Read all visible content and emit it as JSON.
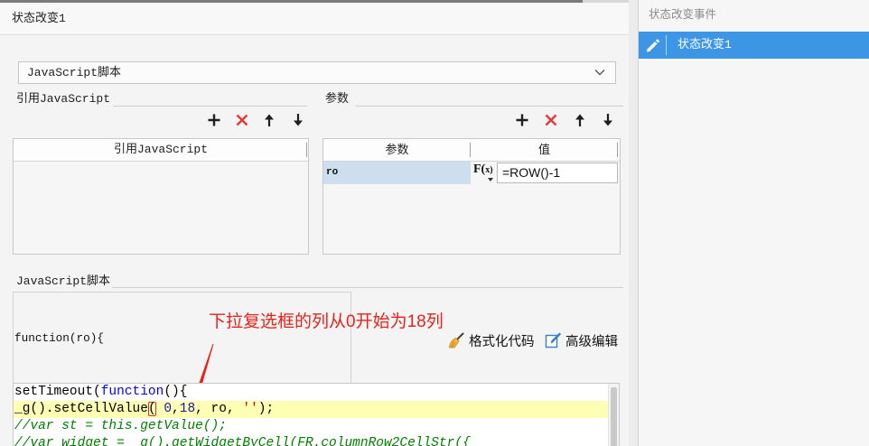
{
  "window": {
    "title": "状态改变1"
  },
  "type_select": {
    "value": "JavaScript脚本",
    "icon": "chevron-down-icon"
  },
  "ref_js": {
    "label": "引用JavaScript",
    "header": "引用JavaScript",
    "toolbar_icons": [
      "add-icon",
      "delete-icon",
      "move-up-icon",
      "move-down-icon"
    ],
    "rows": []
  },
  "params": {
    "label": "参数",
    "headers": {
      "name": "参数",
      "value": "值"
    },
    "toolbar_icons": [
      "add-icon",
      "delete-icon",
      "move-up-icon",
      "move-down-icon"
    ],
    "rows": [
      {
        "name": "ro",
        "formula_button": "F(x)",
        "value": "=ROW()-1",
        "selected": true
      }
    ]
  },
  "script": {
    "label": "JavaScript脚本",
    "signature": "function(ro){",
    "format_button": {
      "label": "格式化代码",
      "icon": "broom-icon"
    },
    "advanced_button": {
      "label": "高级编辑",
      "icon": "edit-icon"
    },
    "active_line": 1,
    "lines": [
      [
        {
          "text": "setTimeout(",
          "color": "#000000"
        },
        {
          "text": "function",
          "color": "#0000ff"
        },
        {
          "text": "(){",
          "color": "#000000"
        }
      ],
      [
        {
          "text": "_g().setCellValue",
          "color": "#000000"
        },
        {
          "text": "(",
          "color": "#000000",
          "match": true
        },
        {
          "text": " 0",
          "color": "#1a1aa6"
        },
        {
          "text": ",",
          "color": "#000000"
        },
        {
          "text": "18",
          "color": "#1a1aa6"
        },
        {
          "text": ", ro, ",
          "color": "#000000"
        },
        {
          "text": "''",
          "color": "#d40000"
        },
        {
          "text": ");",
          "color": "#000000"
        }
      ],
      [
        {
          "text": "//var st = this.getValue();",
          "color": "#008000",
          "italic": true
        }
      ],
      [
        {
          "text": "//var widget = _g().getWidgetByCell(FR.columnRow2CellStr({",
          "color": "#008000",
          "italic": true
        }
      ]
    ]
  },
  "annotation": {
    "text": "下拉复选框的列从0开始为18列",
    "color": "#e8221b"
  },
  "events": {
    "header": "状态改变事件",
    "items": [
      {
        "label": "状态改变1",
        "icon": "pencil-icon",
        "selected": true
      }
    ]
  },
  "colors": {
    "accent": "#3d95e5",
    "delete": "#e53935",
    "row_selected": "#cddfee",
    "active_line": "#ffffb4"
  }
}
